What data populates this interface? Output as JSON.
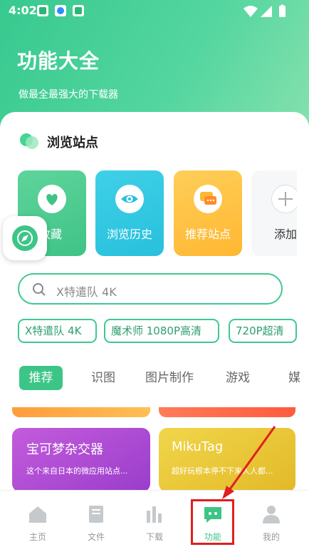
{
  "status_bar": {
    "time": "4:02"
  },
  "header": {
    "title": "功能大全",
    "subtitle": "做最全最强大的下载器"
  },
  "browse": {
    "title": "浏览站点",
    "cards": [
      {
        "label": "址收藏",
        "icon": "heart-icon"
      },
      {
        "label": "浏览历史",
        "icon": "eye-icon"
      },
      {
        "label": "推荐站点",
        "icon": "chat-bubble-icon"
      },
      {
        "label": "添加",
        "icon": "plus-icon"
      }
    ]
  },
  "search": {
    "placeholder": "X特遣队 4K"
  },
  "chips": [
    "X特遣队 4K",
    "魔术师 1080P高清",
    "720P超清"
  ],
  "tabs": [
    "推荐",
    "识图",
    "图片制作",
    "游戏",
    "媒"
  ],
  "games": [
    {
      "title": "宝可梦杂交器",
      "desc": "这个来自日本的微应用站点..."
    },
    {
      "title": "MikuTag",
      "desc": "超好玩根本停不下来人人都..."
    }
  ],
  "bottom_nav": [
    {
      "label": "主页",
      "icon": "home-icon"
    },
    {
      "label": "文件",
      "icon": "book-icon"
    },
    {
      "label": "下载",
      "icon": "bar-chart-icon"
    },
    {
      "label": "功能",
      "icon": "function-chat-icon"
    },
    {
      "label": "我的",
      "icon": "user-icon"
    }
  ],
  "colors": {
    "accent": "#3dc587",
    "header_gradient_start": "#37c98f",
    "highlight": "#e01f1f"
  }
}
